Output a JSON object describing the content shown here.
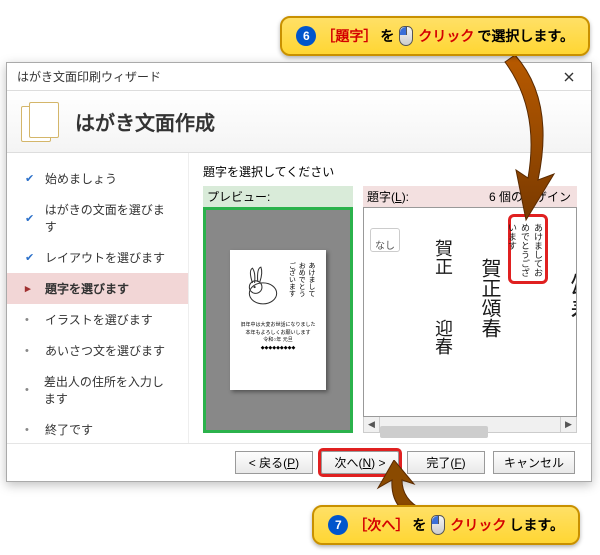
{
  "callouts": {
    "top": {
      "num": "6",
      "bracketed": "［題字］",
      "mid": "を",
      "action": "クリック",
      "tail": "で選択します。"
    },
    "bottom": {
      "num": "7",
      "bracketed": "［次へ］",
      "mid": "を",
      "action": "クリック",
      "tail": "します。"
    }
  },
  "dialog": {
    "title": "はがき文面印刷ウィザード",
    "heading": "はがき文面作成",
    "steps": [
      {
        "label": "始めましょう",
        "state": "done"
      },
      {
        "label": "はがきの文面を選びます",
        "state": "done"
      },
      {
        "label": "レイアウトを選びます",
        "state": "done"
      },
      {
        "label": "題字を選びます",
        "state": "current"
      },
      {
        "label": "イラストを選びます",
        "state": "pending"
      },
      {
        "label": "あいさつ文を選びます",
        "state": "pending"
      },
      {
        "label": "差出人の住所を入力します",
        "state": "pending"
      },
      {
        "label": "終了です",
        "state": "pending"
      }
    ],
    "content": {
      "instruction": "題字を選択してください",
      "preview_label": "プレビュー:",
      "picker_label_pre": "題字(",
      "picker_label_key": "L",
      "picker_label_post": "):",
      "design_count": "6 個のデザイン",
      "designs": {
        "none": "なし",
        "d1a": "賀正",
        "d1b": "迎春",
        "d2": "賀正頌春",
        "sel": "あけましておめでとうございます",
        "partial": "頌春"
      }
    },
    "buttons": {
      "back_pre": "< 戻る(",
      "back_key": "P",
      "back_post": ")",
      "next_pre": "次へ(",
      "next_key": "N",
      "next_post": ") >",
      "finish_pre": "完了(",
      "finish_key": "F",
      "finish_post": ")",
      "cancel": "キャンセル"
    }
  }
}
